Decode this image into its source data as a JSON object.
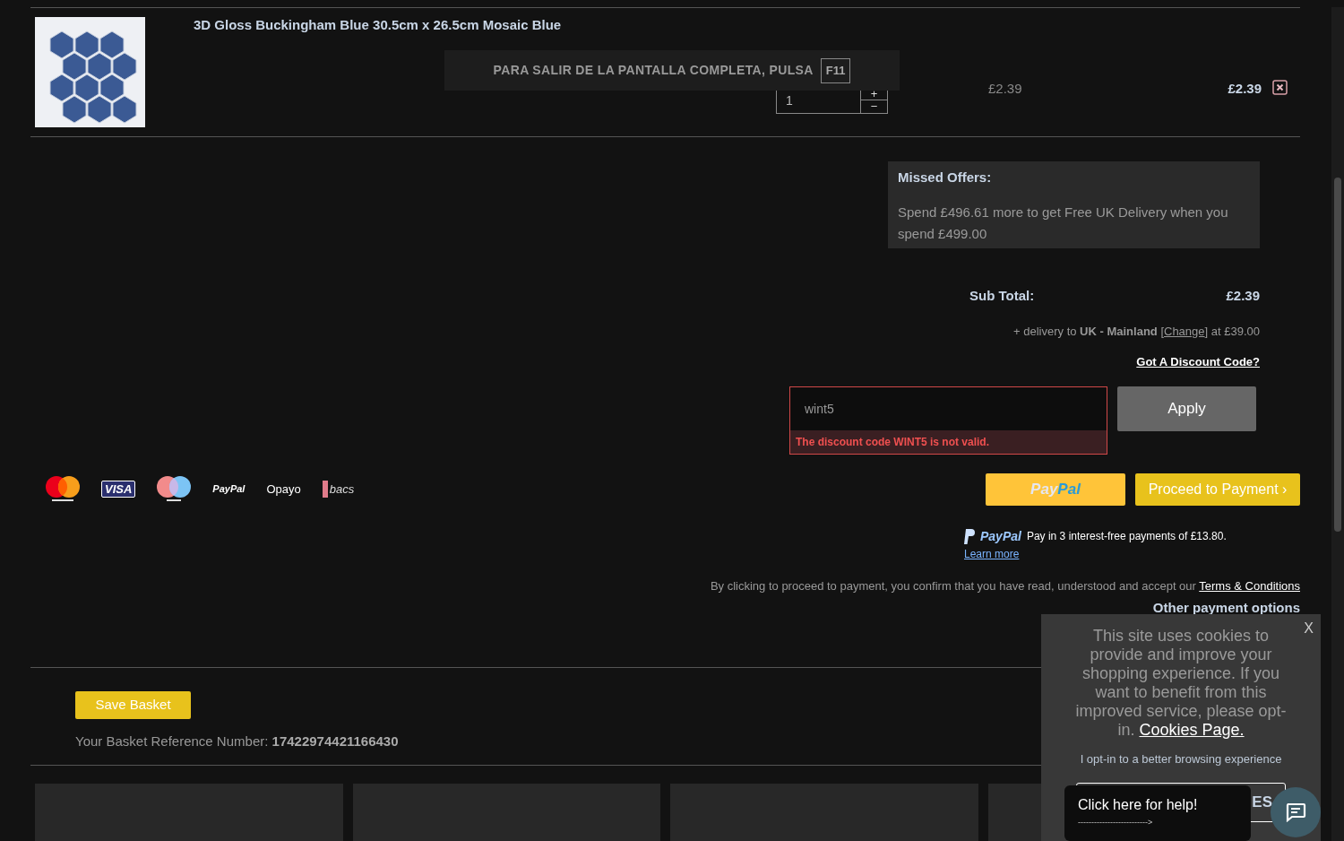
{
  "basket_item": {
    "title": "3D Gloss Buckingham Blue 30.5cm x 26.5cm Mosaic Blue",
    "quantity": "1",
    "increment": "+",
    "decrement": "−",
    "unit_price": "£2.39",
    "line_total": "£2.39"
  },
  "fullscreen_notice": {
    "text": "PARA SALIR DE LA PANTALLA COMPLETA, PULSA",
    "key": "F11"
  },
  "missed_offers": {
    "title": "Missed Offers:",
    "text": "Spend £496.61 more to get Free UK Delivery when you spend £499.00"
  },
  "subtotal": {
    "label": "Sub Total:",
    "value": "£2.39"
  },
  "delivery": {
    "text": "+ delivery to **UK - Mainland** [",
    "link": "Change",
    "suffix": "] at £39.00"
  },
  "discount": {
    "link": "Got A Discount Code?",
    "value": "wint5",
    "error": "The discount code WINT5 is not valid.",
    "button": "Apply"
  },
  "payment_logos": [
    {
      "kind": "mastercard"
    },
    {
      "kind": "visa",
      "text": "VISA"
    },
    {
      "kind": "maestro"
    },
    {
      "kind": "paypal",
      "text": "PayPal"
    },
    {
      "kind": "opayo",
      "text": "Opayo"
    },
    {
      "kind": "bacs",
      "text": "bacs"
    }
  ],
  "paypal_button": {
    "pay": "Pay",
    "pal": "Pal"
  },
  "proceed_button": "Proceed to Payment ›",
  "pay_later": {
    "brand": "PayPal",
    "text": "Pay in 3 interest-free payments of £13.80.",
    "link": "Learn more"
  },
  "terms": {
    "text": "By clicking to proceed to payment, you confirm that you have read, understood and accept our",
    "link": "Terms & Conditions"
  },
  "other_payment_options": "Other payment options",
  "save_basket_button": "Save Basket",
  "reference": {
    "label": "Your Basket Reference Number:",
    "value": "17422974421166430"
  },
  "cards": [
    {
      "kind": "card"
    },
    {
      "kind": "card"
    },
    {
      "kind": "card"
    },
    {
      "kind": "card"
    }
  ],
  "cookie_popup": {
    "close": "X",
    "text": "This site uses cookies to provide and improve your shopping experience. If you want to benefit from this improved service, please opt-in.",
    "link": "Cookies Page.",
    "opt_in": "I opt-in to a better browsing experience",
    "button": "ES"
  },
  "help_bubble": {
    "text": "Click here for help!",
    "arrow": "-------------------------->"
  }
}
